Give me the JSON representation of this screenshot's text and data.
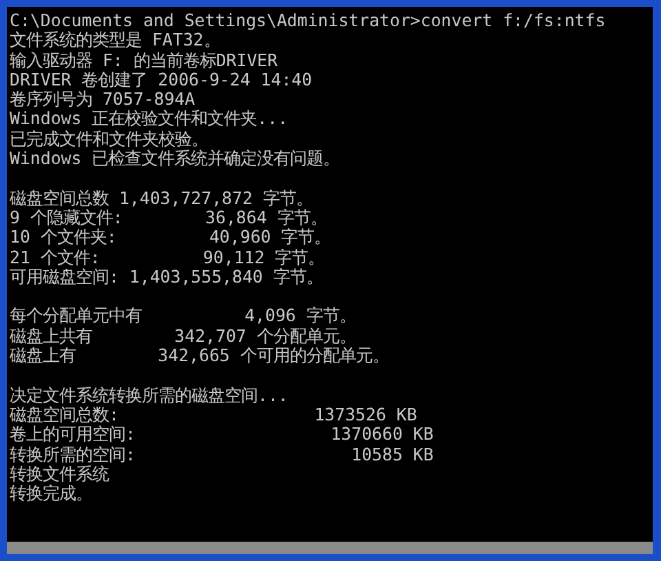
{
  "console": {
    "blocks": [
      [
        "C:\\Documents and Settings\\Administrator>convert f:/fs:ntfs",
        "文件系统的类型是 FAT32。",
        "输入驱动器 F: 的当前卷标DRIVER",
        "DRIVER 卷创建了 2006-9-24 14:40",
        "卷序列号为 7057-894A",
        "Windows 正在校验文件和文件夹...",
        "已完成文件和文件夹校验。",
        "Windows 已检查文件系统并确定没有问题。"
      ],
      [
        "磁盘空间总数 1,403,727,872 字节。",
        "9 个隐藏文件:        36,864 字节。",
        "10 个文件夹:         40,960 字节。",
        "21 个文件:          90,112 字节。",
        "可用磁盘空间: 1,403,555,840 字节。"
      ],
      [
        "每个分配单元中有          4,096 字节。",
        "磁盘上共有        342,707 个分配单元。",
        "磁盘上有        342,665 个可用的分配单元。"
      ],
      [
        "决定文件系统转换所需的磁盘空间...",
        "磁盘空间总数:                   1373526 KB",
        "卷上的可用空间:                   1370660 KB",
        "转换所需的空间:                     10585 KB",
        "转换文件系统",
        "转换完成。"
      ]
    ]
  }
}
